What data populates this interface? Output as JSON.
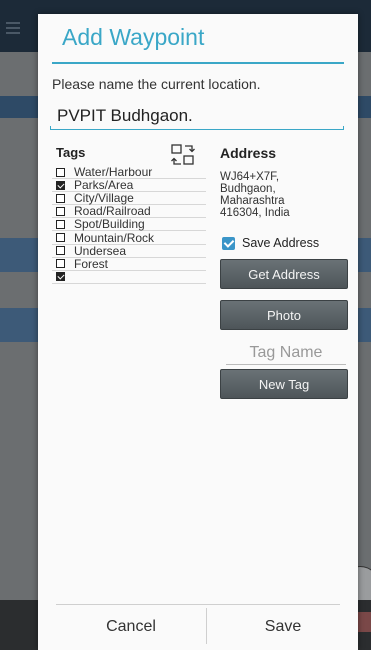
{
  "dialog": {
    "title": "Add Waypoint",
    "prompt": "Please name the current location.",
    "name_value": "PVPIT Budhgaon."
  },
  "tags": {
    "heading": "Tags",
    "toggle_icon": "swap-icon",
    "items": [
      {
        "label": "Water/Harbour",
        "checked": false
      },
      {
        "label": "Parks/Area",
        "checked": true
      },
      {
        "label": "City/Village",
        "checked": false
      },
      {
        "label": "Road/Railroad",
        "checked": false
      },
      {
        "label": "Spot/Building",
        "checked": false
      },
      {
        "label": "Mountain/Rock",
        "checked": false
      },
      {
        "label": "Undersea",
        "checked": false
      },
      {
        "label": "Forest",
        "checked": false
      },
      {
        "label": "",
        "checked": true
      }
    ]
  },
  "address": {
    "heading": "Address",
    "line1": "WJ64+X7F,",
    "line2": "Budhgaon,",
    "line3": "Maharashtra",
    "line4": "416304, India",
    "save_label": "Save Address",
    "save_checked": true,
    "get_button": "Get Address",
    "photo_button": "Photo",
    "tag_name_placeholder": "Tag Name",
    "new_tag_button": "New Tag"
  },
  "footer": {
    "cancel": "Cancel",
    "save": "Save"
  },
  "colors": {
    "accent": "#3aa7c7",
    "button": "#5a6266"
  }
}
